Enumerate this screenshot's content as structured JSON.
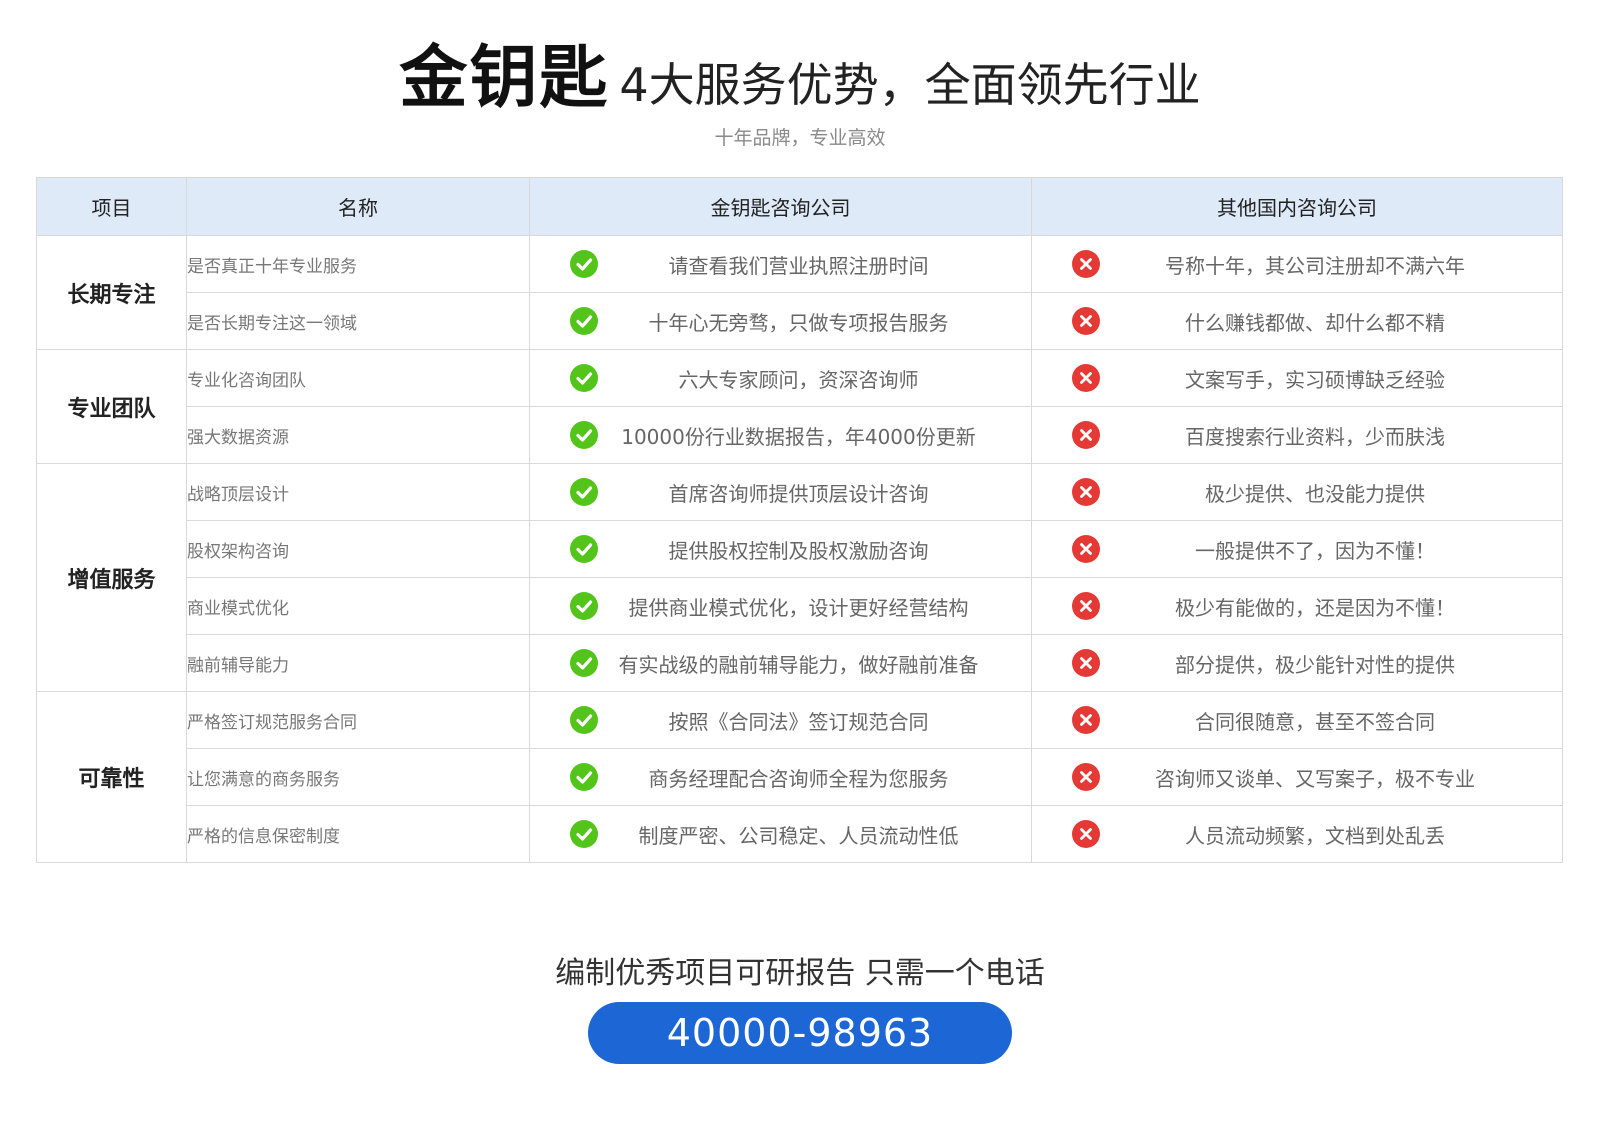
{
  "header": {
    "brand": "金钥匙",
    "title": "4大服务优势，全面领先行业",
    "subtitle": "十年品牌，专业高效"
  },
  "table": {
    "headers": [
      "项目",
      "名称",
      "金钥匙咨询公司",
      "其他国内咨询公司"
    ],
    "groups": [
      {
        "category": "长期专注",
        "rows": [
          {
            "name": "是否真正十年专业服务",
            "ours": "请查看我们营业执照注册时间",
            "others": "号称十年，其公司注册却不满六年"
          },
          {
            "name": "是否长期专注这一领域",
            "ours": "十年心无旁骛，只做专项报告服务",
            "others": "什么赚钱都做、却什么都不精"
          }
        ]
      },
      {
        "category": "专业团队",
        "rows": [
          {
            "name": "专业化咨询团队",
            "ours": "六大专家顾问，资深咨询师",
            "others": "文案写手，实习硕博缺乏经验"
          },
          {
            "name": "强大数据资源",
            "ours": "10000份行业数据报告，年4000份更新",
            "others": "百度搜索行业资料，少而肤浅"
          }
        ]
      },
      {
        "category": "增值服务",
        "rows": [
          {
            "name": "战略顶层设计",
            "ours": "首席咨询师提供顶层设计咨询",
            "others": "极少提供、也没能力提供"
          },
          {
            "name": "股权架构咨询",
            "ours": "提供股权控制及股权激励咨询",
            "others": "一般提供不了，因为不懂！"
          },
          {
            "name": "商业模式优化",
            "ours": "提供商业模式优化，设计更好经营结构",
            "others": "极少有能做的，还是因为不懂！"
          },
          {
            "name": "融前辅导能力",
            "ours": "有实战级的融前辅导能力，做好融前准备",
            "others": "部分提供，极少能针对性的提供"
          }
        ]
      },
      {
        "category": "可靠性",
        "rows": [
          {
            "name": "严格签订规范服务合同",
            "ours": "按照《合同法》签订规范合同",
            "others": "合同很随意，甚至不签合同"
          },
          {
            "name": "让您满意的商务服务",
            "ours": "商务经理配合咨询师全程为您服务",
            "others": "咨询师又谈单、又写案子，极不专业"
          },
          {
            "name": "严格的信息保密制度",
            "ours": "制度严密、公司稳定、人员流动性低",
            "others": "人员流动频繁，文档到处乱丢"
          }
        ]
      }
    ]
  },
  "cta": {
    "text": "编制优秀项目可研报告 只需一个电话",
    "phone": "40000-98963"
  },
  "icons": {
    "yes": "check-circle-icon",
    "no": "cross-circle-icon"
  },
  "colors": {
    "header_bg": "#deeaf8",
    "check": "#52c41a",
    "cross": "#e53935",
    "button": "#1c66d6"
  }
}
